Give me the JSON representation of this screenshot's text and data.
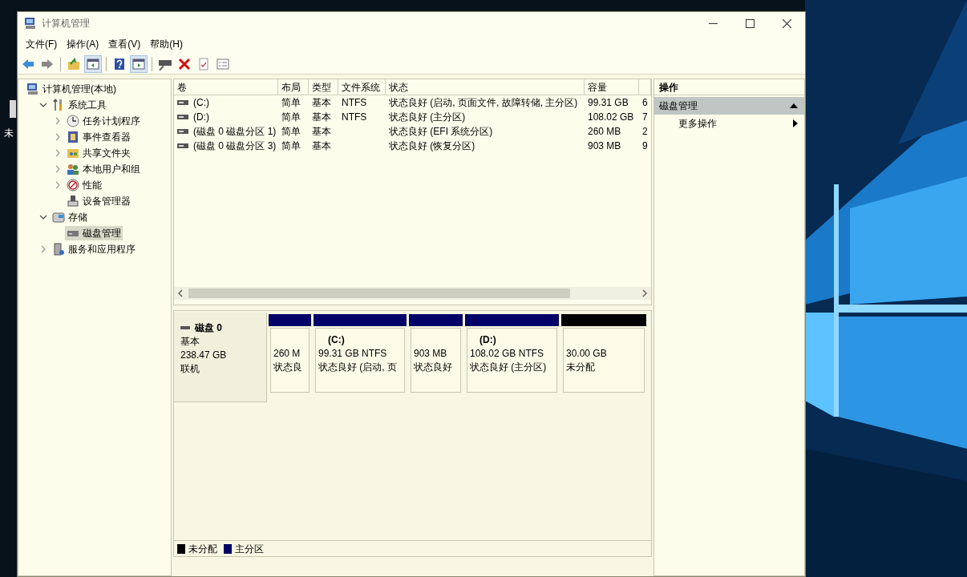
{
  "desktop": {
    "label": "未"
  },
  "window": {
    "title": "计算机管理"
  },
  "menu": [
    "文件(F)",
    "操作(A)",
    "查看(V)",
    "帮助(H)"
  ],
  "toolbar": [
    {
      "kind": "back",
      "pressed": false
    },
    {
      "kind": "forward",
      "pressed": false
    },
    {
      "kind": "sep"
    },
    {
      "kind": "folder-up",
      "pressed": false
    },
    {
      "kind": "tree-pane",
      "pressed": true
    },
    {
      "kind": "sep"
    },
    {
      "kind": "help",
      "pressed": false
    },
    {
      "kind": "action-pane",
      "pressed": true
    },
    {
      "kind": "sep"
    },
    {
      "kind": "disk",
      "pressed": false
    },
    {
      "kind": "delete",
      "pressed": false
    },
    {
      "kind": "check",
      "pressed": false
    },
    {
      "kind": "properties",
      "pressed": false
    }
  ],
  "tree": [
    {
      "label": "计算机管理(本地)",
      "kind": "computer",
      "selected": false,
      "children": [
        {
          "label": "系统工具",
          "kind": "tools",
          "expanded": true,
          "selected": false,
          "children": [
            {
              "label": "任务计划程序",
              "kind": "clock",
              "expanded": false,
              "selected": false
            },
            {
              "label": "事件查看器",
              "kind": "event",
              "expanded": false,
              "selected": false
            },
            {
              "label": "共享文件夹",
              "kind": "share",
              "expanded": false,
              "selected": false
            },
            {
              "label": "本地用户和组",
              "kind": "users",
              "expanded": false,
              "selected": false
            },
            {
              "label": "性能",
              "kind": "perf",
              "expanded": false,
              "selected": false
            },
            {
              "label": "设备管理器",
              "kind": "device",
              "selected": false
            }
          ]
        },
        {
          "label": "存储",
          "kind": "storage",
          "expanded": true,
          "selected": false,
          "children": [
            {
              "label": "磁盘管理",
              "kind": "disk",
              "selected": true
            }
          ]
        },
        {
          "label": "服务和应用程序",
          "kind": "services",
          "expanded": false,
          "selected": false
        }
      ]
    }
  ],
  "table": {
    "columns": [
      "卷",
      "布局",
      "类型",
      "文件系统",
      "状态",
      "容量"
    ],
    "rows": [
      {
        "cells": [
          "(C:)",
          "简单",
          "基本",
          "NTFS",
          "状态良好 (启动, 页面文件, 故障转储, 主分区)",
          "99.31 GB",
          "6"
        ]
      },
      {
        "cells": [
          "(D:)",
          "简单",
          "基本",
          "NTFS",
          "状态良好 (主分区)",
          "108.02 GB",
          "7"
        ]
      },
      {
        "cells": [
          "(磁盘 0 磁盘分区 1)",
          "简单",
          "基本",
          "",
          "状态良好 (EFI 系统分区)",
          "260 MB",
          "2"
        ]
      },
      {
        "cells": [
          "(磁盘 0 磁盘分区 3)",
          "简单",
          "基本",
          "",
          "状态良好 (恢复分区)",
          "903 MB",
          "9"
        ]
      }
    ]
  },
  "disk": {
    "name": "磁盘 0",
    "type": "基本",
    "size": "238.47 GB",
    "status": "联机",
    "partitions": [
      {
        "color": "#000066",
        "size": "260 M",
        "status": "状态良"
      },
      {
        "color": "#000066",
        "label": "(C:)",
        "size": "99.31 GB NTFS",
        "status": "状态良好 (启动, 页"
      },
      {
        "color": "#000066",
        "size": "903 MB",
        "status": "状态良好"
      },
      {
        "color": "#000066",
        "label": "(D:)",
        "size": "108.02 GB NTFS",
        "status": "状态良好 (主分区)"
      },
      {
        "color": "#000000",
        "size": "30.00 GB",
        "status": "未分配"
      }
    ]
  },
  "legend": [
    {
      "color": "#000000",
      "label": "未分配"
    },
    {
      "color": "#000066",
      "label": "主分区"
    }
  ],
  "actions": {
    "header": "操作",
    "section": "磁盘管理",
    "items": [
      "更多操作"
    ]
  }
}
